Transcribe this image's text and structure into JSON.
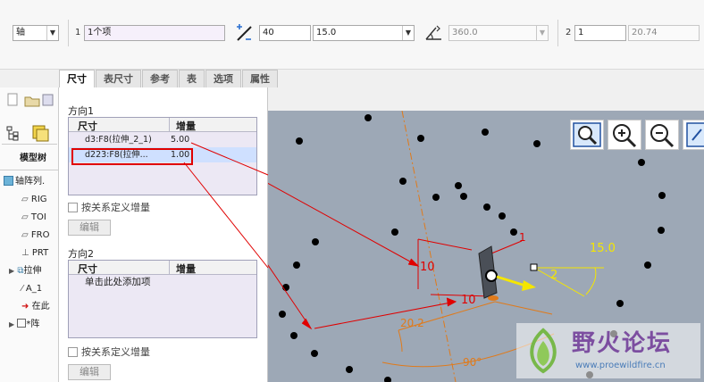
{
  "toolbar": {
    "pattern_type": "轴",
    "dir1_index": "1",
    "dir1_items": "1个项",
    "dir1_spacing": "40",
    "angle_value": "15.0",
    "angle_extent": "360.0",
    "dir2_index": "2",
    "dir2_count": "1",
    "dir2_spacing": "20.74",
    "icons": [
      "percent-slash-icon",
      "angle-extent-icon"
    ]
  },
  "tabs": [
    "尺寸",
    "表尺寸",
    "参考",
    "表",
    "选项",
    "属性"
  ],
  "model_tree": {
    "label": "模型树",
    "items": [
      "轴阵列.",
      "RIG",
      "TOI",
      "FRO",
      "PRT",
      "拉伸",
      "A_1",
      "在此",
      "*阵"
    ]
  },
  "direction1": {
    "title": "方向1",
    "headers": [
      "尺寸",
      "增量"
    ],
    "rows": [
      {
        "dim": "d3:F8(拉伸_2_1)",
        "inc": "5.00"
      },
      {
        "dim": "d223:F8(拉伸...",
        "inc": "1.00"
      }
    ],
    "checkbox_label": "按关系定义增量",
    "edit_label": "编辑"
  },
  "direction2": {
    "title": "方向2",
    "headers": [
      "尺寸",
      "增量"
    ],
    "placeholder_row": "单击此处添加项",
    "checkbox_label": "按关系定义增量",
    "edit_label": "编辑"
  },
  "canvas": {
    "dim_labels": [
      "10",
      "10",
      "1",
      "2",
      "15.0",
      "20.2",
      "90°"
    ],
    "zoom_icons": [
      "zoom-fit-icon",
      "zoom-in-icon",
      "zoom-out-icon",
      "repaint-icon"
    ]
  },
  "watermark": {
    "title": "野火论坛",
    "url": "www.proewildfire.cn"
  },
  "colors": {
    "highlight_row": "#cfe0ff",
    "annotation_red": "#e00000",
    "viewport_bg": "#9da8b6",
    "dim_orange": "#e07a1a",
    "dim_yellow": "#f5e600"
  }
}
